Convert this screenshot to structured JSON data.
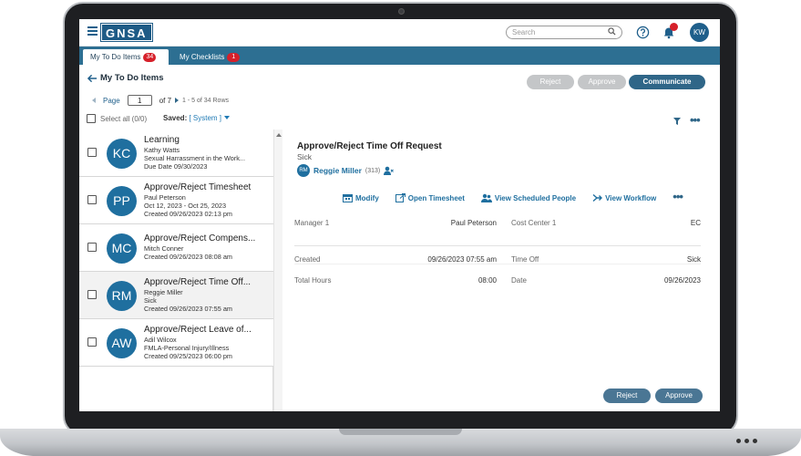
{
  "app": {
    "logo": "GNSA",
    "search_placeholder": "Search",
    "user_initials": "KW"
  },
  "tabs": [
    {
      "label": "My To Do Items",
      "count": "34",
      "active": true
    },
    {
      "label": "My Checklists",
      "count": "1",
      "active": false
    }
  ],
  "header": {
    "title": "My To Do Items",
    "reject_label": "Reject",
    "approve_label": "Approve",
    "communicate_label": "Communicate"
  },
  "pager": {
    "page_label": "Page",
    "page_value": "1",
    "of_label": "of 7",
    "rows_label": "1 - 5 of 34 Rows"
  },
  "toolbar": {
    "select_all_label": "Select all (0/0)",
    "saved_label": "Saved:",
    "saved_value": "[ System ]"
  },
  "list": [
    {
      "initials": "KC",
      "title": "Learning",
      "line1": "Kathy Watts",
      "line2": "Sexual Harrassment in the Work...",
      "line3": "Due Date 09/30/2023",
      "selected": false
    },
    {
      "initials": "PP",
      "title": "Approve/Reject Timesheet",
      "line1": "Paul Peterson",
      "line2": "Oct 12, 2023 - Oct 25, 2023",
      "line3": "Created 09/26/2023 02:13 pm",
      "selected": false
    },
    {
      "initials": "MC",
      "title": "Approve/Reject Compens...",
      "line1": "Mitch Conner",
      "line2": "Created 09/26/2023 08:08 am",
      "line3": "",
      "selected": false
    },
    {
      "initials": "RM",
      "title": "Approve/Reject Time Off...",
      "line1": "Reggie Miller",
      "line2": "Sick",
      "line3": "Created 09/26/2023 07:55 am",
      "selected": true
    },
    {
      "initials": "AW",
      "title": "Approve/Reject Leave of...",
      "line1": "Adil Wilcox",
      "line2": "FMLA-Personal Injury/Illness",
      "line3": "Created 09/25/2023 06:00 pm",
      "selected": false
    }
  ],
  "detail": {
    "title": "Approve/Reject Time Off Request",
    "subtitle": "Sick",
    "person_initials": "RM",
    "person_name": "Reggie Miller",
    "person_id": "(313)",
    "actions": {
      "modify": "Modify",
      "open_timesheet": "Open Timesheet",
      "view_scheduled": "View Scheduled People",
      "view_workflow": "View Workflow"
    },
    "manager_label": "Manager 1",
    "manager_value": "Paul Peterson",
    "cost_center_label": "Cost Center 1",
    "cost_center_value": "EC",
    "created_label": "Created",
    "created_value": "09/26/2023 07:55 am",
    "time_off_label": "Time Off",
    "time_off_value": "Sick",
    "total_hours_label": "Total Hours",
    "total_hours_value": "08:00",
    "date_label": "Date",
    "date_value": "09/26/2023",
    "reject_label": "Reject",
    "approve_label": "Approve"
  },
  "colors": {
    "brand": "#1e5b86",
    "tab_bar": "#2d6f92",
    "badge": "#d6202a",
    "avatar": "#1f6f9f"
  }
}
